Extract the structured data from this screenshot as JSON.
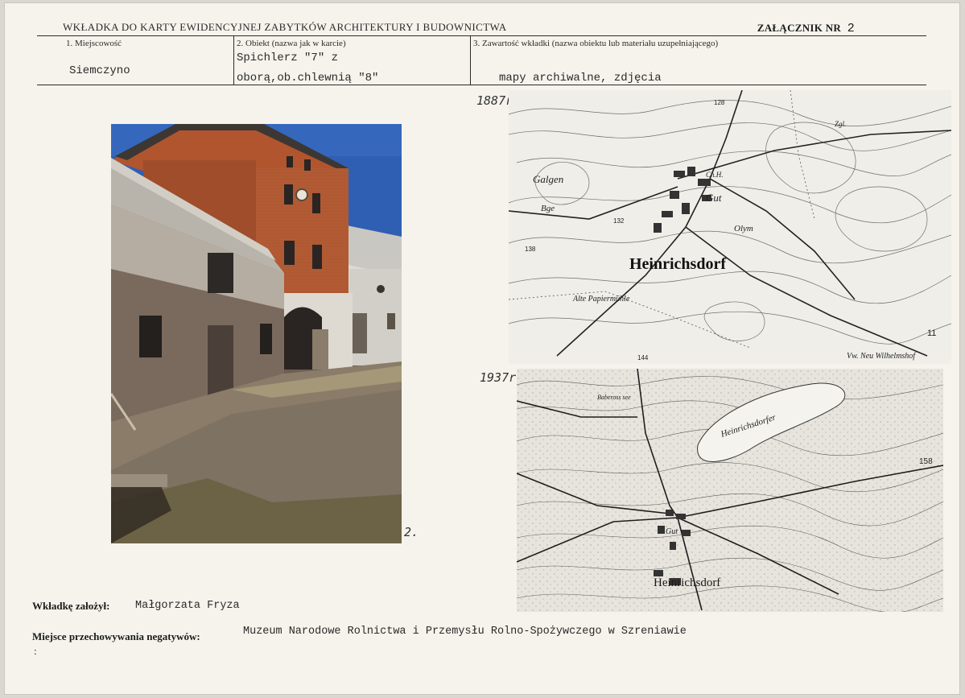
{
  "header": {
    "title": "WKŁADKA DO KARTY EWIDENCYJNEJ ZABYTKÓW ARCHITEKTURY I BUDOWNICTWA",
    "attachment_label": "ZAŁĄCZNIK NR",
    "attachment_number": "2"
  },
  "fields": {
    "locality_label": "1. Miejscowość",
    "locality_value": "Siemczyno",
    "object_label": "2. Obiekt (nazwa jak w karcie)",
    "object_value_line1": "Spichlerz \"7\" z",
    "object_value_line2": "oborą,ob.chlewnią \"8\"",
    "content_label": "3. Zawartość wkładki (nazwa obiektu lub materiału uzupełniającego)",
    "content_value": "mapy archiwalne, zdjęcia"
  },
  "photo": {
    "caption": "2."
  },
  "maps": [
    {
      "year_note": "1887r.",
      "labels": {
        "main_village": "Heinrichsdorf",
        "estate": "Gut",
        "hill": "Galgen",
        "hill_suffix": "Bge",
        "mill": "Alte Papiermühle",
        "outlying": "Vw. Neu Wilhelmshof",
        "olym": "Olym",
        "ziegelei": "Zgl.",
        "dh": "Ch.H.",
        "height_1": "138",
        "height_2": "132",
        "height_3": "128",
        "height_4": "144",
        "road_num": "11"
      }
    },
    {
      "year_note": "1937r.",
      "labels": {
        "lake": "Heinrichsdorfer",
        "main_village": "Heinrichsdorf",
        "small_lake": "Babeross see",
        "estate": "Gut",
        "height_1": "158"
      }
    }
  ],
  "footer": {
    "created_by_label": "Wkładkę założył:",
    "created_by_value": "Małgorzata Fryza",
    "negatives_label": "Miejsce przechowywania negatywów:",
    "negatives_value": "Muzeum Narodowe Rolnictwa i Przemysłu Rolno-Spożywczego w Szreniawie",
    "trailing_mark": ":"
  },
  "colors": {
    "paper": "#f5f3ec",
    "sky": "#2f5fb3",
    "brick": "#a8502d",
    "ground": "#8a7c69"
  }
}
